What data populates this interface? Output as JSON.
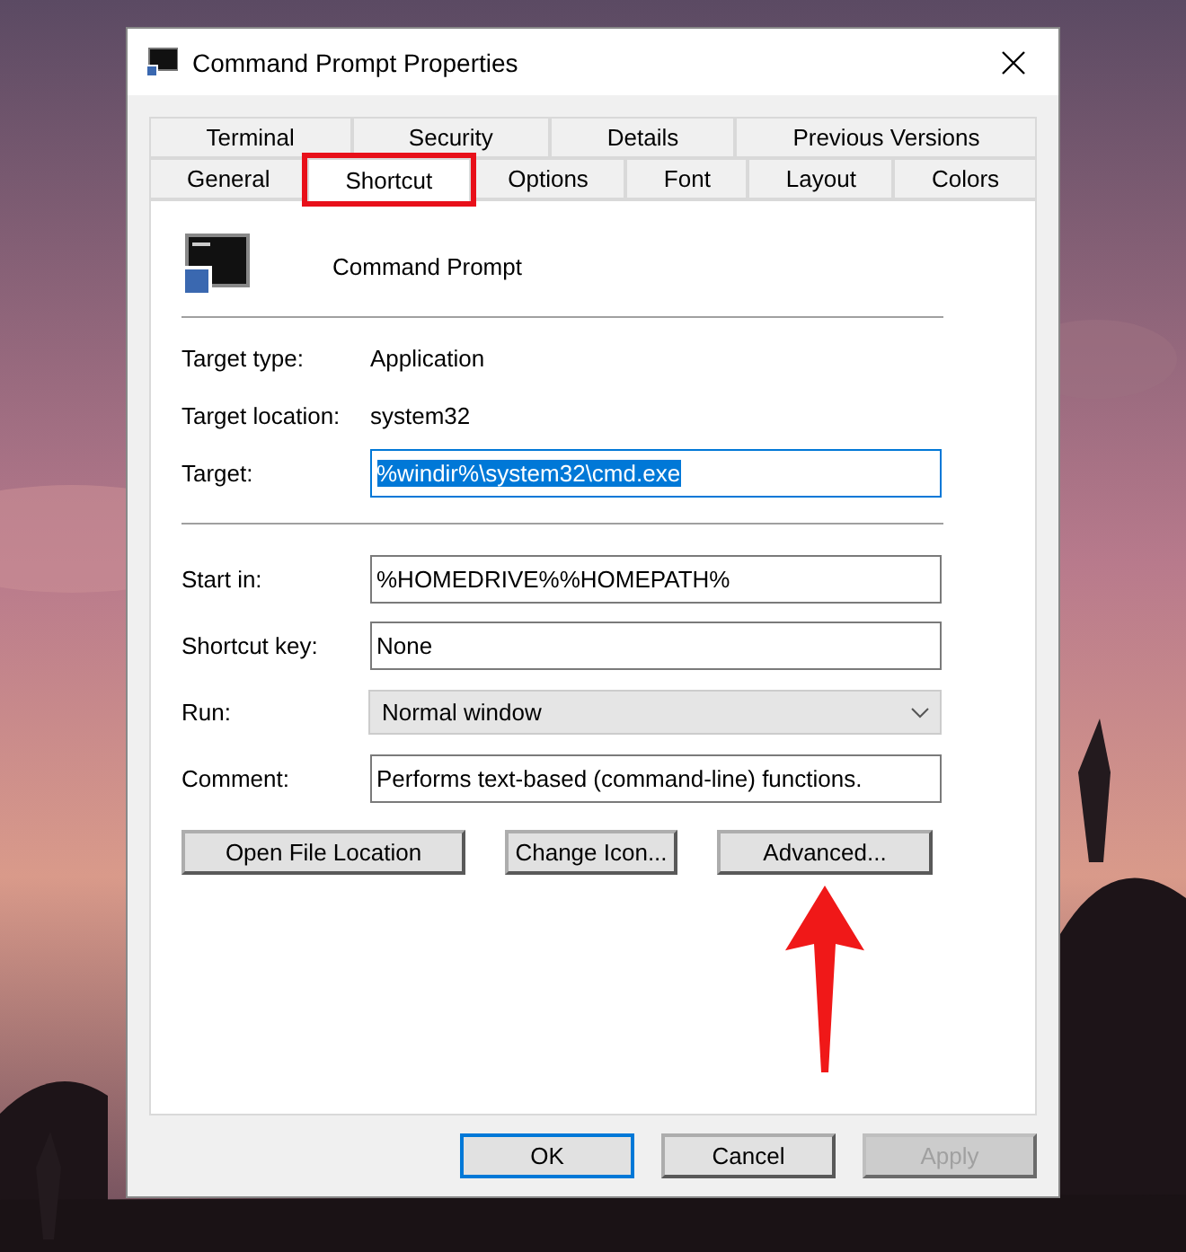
{
  "window": {
    "title": "Command Prompt Properties"
  },
  "tab_rows": [
    {
      "tabs": [
        {
          "label": "Terminal",
          "selected": false,
          "highlighted": false
        },
        {
          "label": "Security",
          "selected": false,
          "highlighted": false
        },
        {
          "label": "Details",
          "selected": false,
          "highlighted": false
        },
        {
          "label": "Previous Versions",
          "selected": false,
          "highlighted": false
        }
      ]
    },
    {
      "tabs": [
        {
          "label": "General",
          "selected": false,
          "highlighted": false
        },
        {
          "label": "Shortcut",
          "selected": true,
          "highlighted": true
        },
        {
          "label": "Options",
          "selected": false,
          "highlighted": false
        },
        {
          "label": "Font",
          "selected": false,
          "highlighted": false
        },
        {
          "label": "Layout",
          "selected": false,
          "highlighted": false
        },
        {
          "label": "Colors",
          "selected": false,
          "highlighted": false
        }
      ]
    }
  ],
  "shortcut": {
    "name": "Command Prompt",
    "info": [
      {
        "label": "Target type:",
        "value": "Application"
      },
      {
        "label": "Target location:",
        "value": "system32"
      }
    ],
    "target": {
      "label": "Target:",
      "value": "%windir%\\system32\\cmd.exe",
      "selected": true
    },
    "fields": [
      {
        "kind": "text",
        "label": "Start in:",
        "value": "%HOMEDRIVE%%HOMEPATH%"
      },
      {
        "kind": "text",
        "label": "Shortcut key:",
        "value": "None"
      },
      {
        "kind": "dropdown",
        "label": "Run:",
        "value": "Normal window"
      },
      {
        "kind": "text",
        "label": "Comment:",
        "value": "Performs text-based (command-line) functions."
      }
    ],
    "buttons": [
      {
        "label": "Open File Location"
      },
      {
        "label": "Change Icon..."
      },
      {
        "label": "Advanced..."
      }
    ]
  },
  "annotations": {
    "arrow": true
  },
  "footer_buttons": [
    {
      "label": "OK",
      "default": true,
      "disabled": false
    },
    {
      "label": "Cancel",
      "default": false,
      "disabled": false
    },
    {
      "label": "Apply",
      "default": false,
      "disabled": true
    }
  ]
}
